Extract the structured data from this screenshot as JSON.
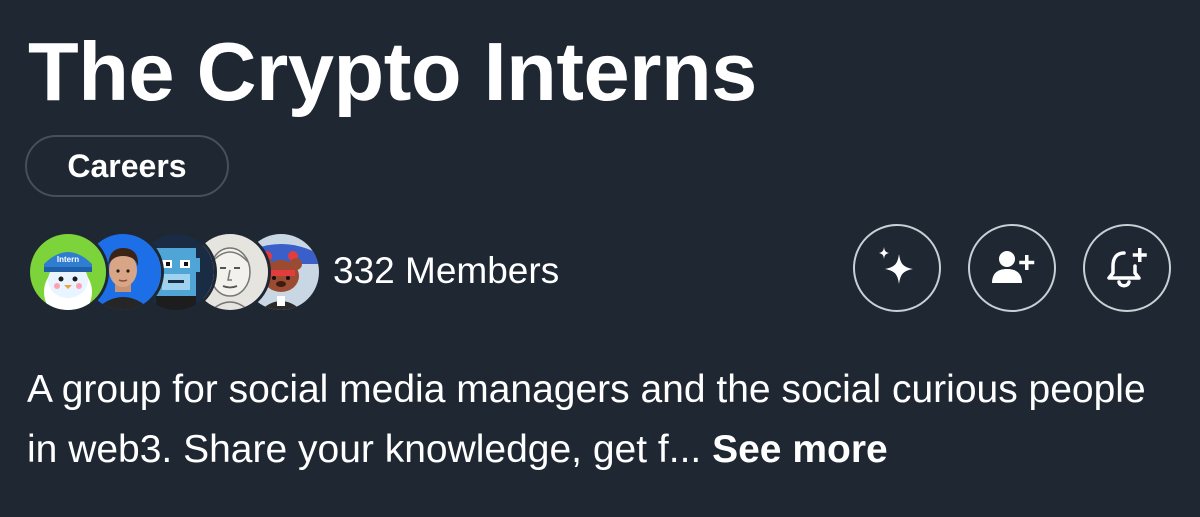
{
  "group": {
    "title": "The Crypto Interns",
    "category": "Careers",
    "members_label": "332 Members",
    "description": "A group for social media managers and the social curious people in web3. Share your knowledge, get f...",
    "see_more_label": "See more"
  },
  "avatars": [
    {
      "name": "penguin-avatar",
      "text": "Intern"
    },
    {
      "name": "person-avatar"
    },
    {
      "name": "pixel-ape-avatar"
    },
    {
      "name": "sketch-face-avatar"
    },
    {
      "name": "bear-avatar"
    }
  ],
  "actions": [
    {
      "name": "sparkle-button",
      "icon": "sparkle-icon"
    },
    {
      "name": "add-member-button",
      "icon": "person-plus-icon"
    },
    {
      "name": "notification-button",
      "icon": "bell-plus-icon"
    }
  ],
  "colors": {
    "background": "#1e2732",
    "text": "#ffffff",
    "border": "#45505b"
  }
}
